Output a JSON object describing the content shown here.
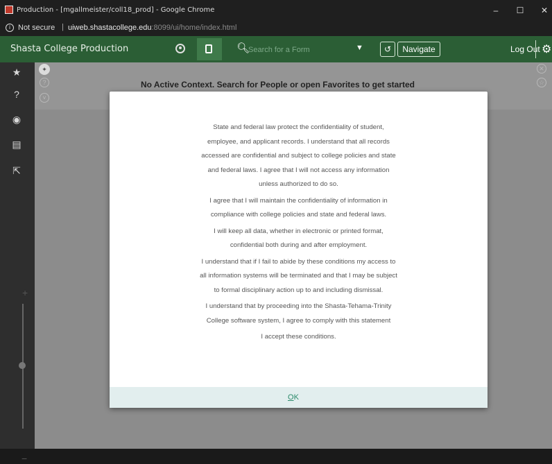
{
  "browser": {
    "window_title": "Production - [mgallmeister/coll18_prod] - Google Chrome",
    "minimize_glyph": "–",
    "maximize_glyph": "☐",
    "close_glyph": "✕",
    "security_label": "Not secure",
    "separator": "|",
    "url_host": "uiweb.shastacollege.edu",
    "url_path": ":8099/ui/home/index.html"
  },
  "app": {
    "title": "Shasta College Production",
    "search_placeholder": "Search for a Form",
    "navigate_label": "Navigate",
    "logout_label": "Log Out",
    "accent_color": "#2b5e35"
  },
  "context": {
    "message": "No Active Context. Search for People or open Favorites to get started"
  },
  "modal": {
    "paragraphs": [
      [
        "State and federal law protect the confidentiality of student,",
        "employee, and applicant records. I understand that all records",
        "accessed are confidential and subject to college policies and state",
        "and federal laws. I agree that I will not access any information",
        "unless authorized to do so."
      ],
      [
        "I agree that I will maintain the confidentiality of information in",
        "compliance with college policies and state and federal laws."
      ],
      [
        "I will keep all data, whether in electronic or printed format,",
        "confidential both during and after employment."
      ],
      [
        "I understand that if I fail to abide by these conditions my access to",
        "all information systems will be terminated and that I may be subject",
        "to formal disciplinary action up to and including dismissal."
      ],
      [
        "I understand that by proceeding into the Shasta-Tehama-Trinity",
        "College software system, I agree to comply with this statement"
      ],
      [
        "I accept these conditions."
      ]
    ],
    "ok_label": "OK"
  }
}
